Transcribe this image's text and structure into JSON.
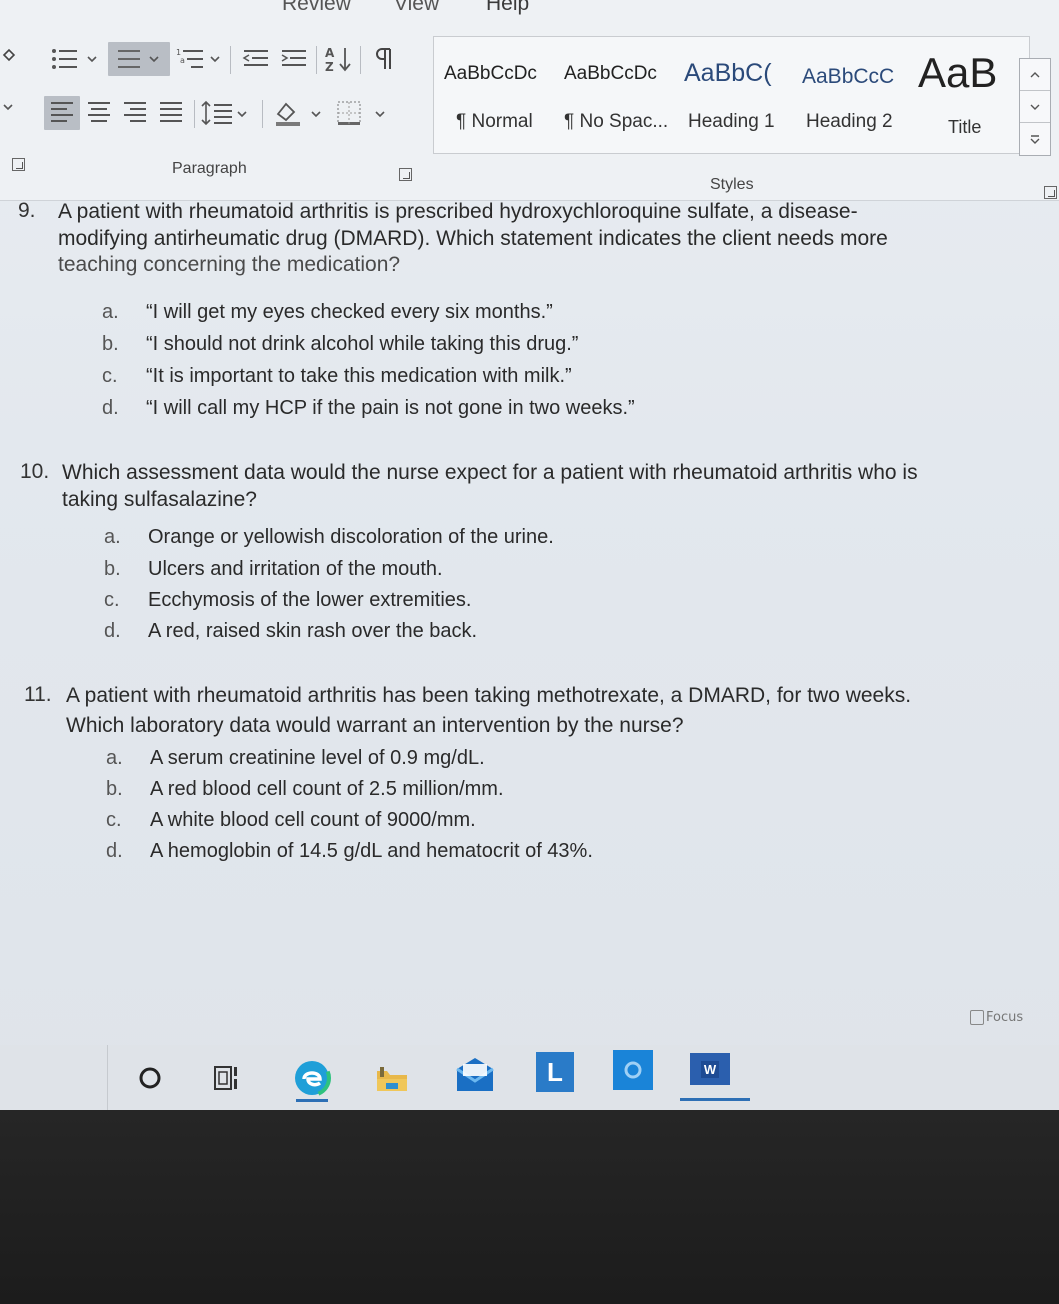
{
  "ribbon": {
    "tabs": [
      "Review",
      "View",
      "Help"
    ],
    "paragraph_label": "Paragraph",
    "styles_label": "Styles",
    "styles": [
      {
        "sample": "AaBbCcDc",
        "name": "¶ Normal"
      },
      {
        "sample": "AaBbCcDc",
        "name": "¶ No Spac..."
      },
      {
        "sample": "AaBbC(",
        "name": "Heading 1"
      },
      {
        "sample": "AaBbCcC",
        "name": "Heading 2"
      },
      {
        "sample": "AaB",
        "name": "Title"
      }
    ]
  },
  "questions": [
    {
      "number": "9.",
      "lines": [
        "A patient with rheumatoid arthritis is prescribed hydroxychloroquine sulfate, a disease-",
        "modifying antirheumatic drug (DMARD). Which statement indicates the client needs more",
        "teaching concerning the medication?"
      ],
      "options": [
        {
          "letter": "a.",
          "text": "“I will get my eyes checked every six months.”"
        },
        {
          "letter": "b.",
          "text": "“I should not drink alcohol while taking this drug.”"
        },
        {
          "letter": "c.",
          "text": "“It is important to take this medication with milk.”"
        },
        {
          "letter": "d.",
          "text": "“I will call my HCP if the pain is not gone in two weeks.”"
        }
      ]
    },
    {
      "number": "10.",
      "lines": [
        "Which assessment data would the nurse expect for a patient with rheumatoid arthritis who is",
        "taking sulfasalazine?"
      ],
      "options": [
        {
          "letter": "a.",
          "text": "Orange or yellowish discoloration of the urine."
        },
        {
          "letter": "b.",
          "text": "Ulcers and irritation of the mouth."
        },
        {
          "letter": "c.",
          "text": "Ecchymosis of the lower extremities."
        },
        {
          "letter": "d.",
          "text": "A red, raised skin rash over the back."
        }
      ]
    },
    {
      "number": "11.",
      "lines": [
        "A patient with rheumatoid arthritis has been taking methotrexate, a DMARD, for two weeks.",
        "Which laboratory data would warrant an intervention by the nurse?"
      ],
      "options": [
        {
          "letter": "a.",
          "text": "A serum creatinine level of 0.9 mg/dL."
        },
        {
          "letter": "b.",
          "text": "A red blood cell count of 2.5 million/mm."
        },
        {
          "letter": "c.",
          "text": "A white blood cell count of 9000/mm."
        },
        {
          "letter": "d.",
          "text": "A hemoglobin of 14.5 g/dL and hematocrit of 43%."
        }
      ]
    }
  ],
  "status": {
    "focus_label": "Focus"
  },
  "taskbar": {
    "icons": [
      "search-circle-icon",
      "task-view-icon",
      "edge-icon",
      "file-explorer-icon",
      "mail-icon",
      "l-app-icon",
      "outlook-icon",
      "word-icon"
    ],
    "l_app_letter": "L",
    "word_letter": "W"
  }
}
